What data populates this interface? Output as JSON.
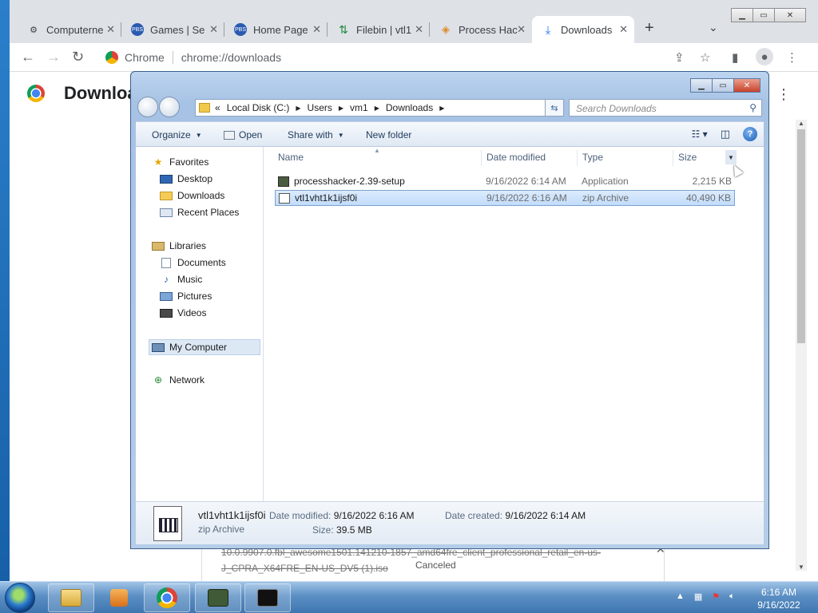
{
  "browser": {
    "tabs": [
      {
        "title": "Computerne",
        "icon": "computer-icon"
      },
      {
        "title": "Games | Se",
        "icon": "pbs-kids-icon"
      },
      {
        "title": "Home Page",
        "icon": "pbs-kids-icon"
      },
      {
        "title": "Filebin | vtl1",
        "icon": "filebin-icon"
      },
      {
        "title": "Process Hac",
        "icon": "process-hacker-icon"
      },
      {
        "title": "Downloads",
        "icon": "download-icon"
      }
    ],
    "omnibox_chip": "Chrome",
    "url": "chrome://downloads",
    "page_title": "Downloads",
    "download_item": {
      "filename": "10.0.9907.0.fbl_awesome1501.141210-1857_amd64fre_client_professional_retail_en-us-J_CPRA_X64FRE_EN-US_DV5 (1).iso",
      "status": "Canceled"
    }
  },
  "explorer": {
    "breadcrumb": {
      "prefix": "«",
      "segments": [
        "Local Disk (C:)",
        "Users",
        "vm1",
        "Downloads"
      ]
    },
    "search_placeholder": "Search Downloads",
    "commands": {
      "organize": "Organize",
      "open": "Open",
      "share_with": "Share with",
      "new_folder": "New folder"
    },
    "nav": {
      "favorites": "Favorites",
      "desktop": "Desktop",
      "downloads": "Downloads",
      "recent_places": "Recent Places",
      "libraries": "Libraries",
      "documents": "Documents",
      "music": "Music",
      "pictures": "Pictures",
      "videos": "Videos",
      "my_computer": "My Computer",
      "network": "Network"
    },
    "columns": {
      "name": "Name",
      "date_modified": "Date modified",
      "type": "Type",
      "size": "Size"
    },
    "files": [
      {
        "name": "processhacker-2.39-setup",
        "date": "9/16/2022 6:14 AM",
        "type": "Application",
        "size": "2,215 KB"
      },
      {
        "name": "vtl1vht1k1ijsf0i",
        "date": "9/16/2022 6:16 AM",
        "type": "zip Archive",
        "size": "40,490 KB"
      }
    ],
    "details": {
      "name": "vtl1vht1k1ijsf0i",
      "type": "zip Archive",
      "date_modified_label": "Date modified:",
      "date_modified": "9/16/2022 6:16 AM",
      "date_created_label": "Date created:",
      "date_created": "9/16/2022 6:14 AM",
      "size_label": "Size:",
      "size": "39.5 MB"
    }
  },
  "taskbar": {
    "time": "6:16 AM",
    "date": "9/16/2022"
  }
}
